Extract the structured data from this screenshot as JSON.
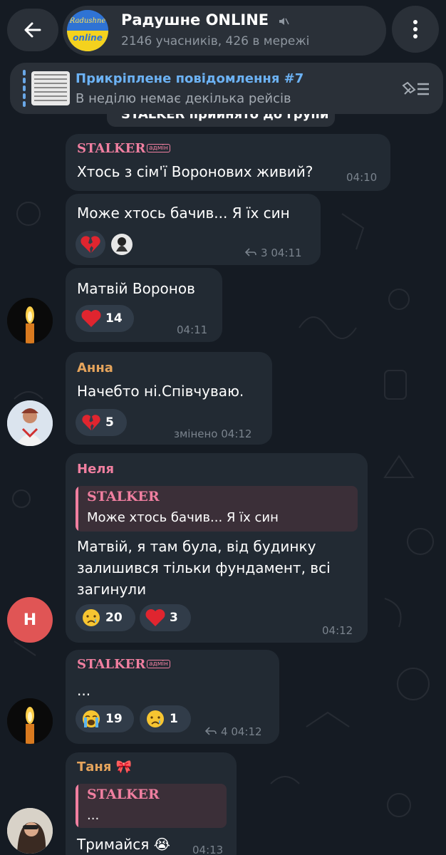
{
  "header": {
    "channel_title": "Радушне ONLINE",
    "channel_subtitle": "2146 учасників, 426 в мережі",
    "avatar_text_top": "Radushne",
    "avatar_text_bottom": "online"
  },
  "pinned": {
    "title": "Прикріплене повідомлення #7",
    "text": "В неділю немає декілька рейсів"
  },
  "service_text": "STALKER прийнято до групи",
  "admin_label": "адмін",
  "colors": {
    "background": "#151b23",
    "bubble": "#222a33",
    "accent_blue": "#6cb2f4",
    "name_pink": "#f07fa0",
    "name_orange": "#e5a45c",
    "reaction_bg": "#313c49"
  },
  "messages": [
    {
      "sender": "STALKER",
      "text": "Хтось з сім'ї Воронових живий?",
      "time": "04:10"
    },
    {
      "text": "Може хтось бачив... Я їх син",
      "forwards": "3",
      "time": "04:11",
      "reactions": [
        {
          "icon": "broken-heart"
        },
        {
          "icon": "avatar-photo"
        }
      ]
    },
    {
      "text": "Матвій Воронов",
      "time": "04:11",
      "reactions": [
        {
          "icon": "red-heart",
          "count": "14"
        }
      ]
    },
    {
      "sender": "Анна",
      "text": "Начебто ні.Співчуваю.",
      "time": "змінено 04:12",
      "reactions": [
        {
          "icon": "broken-heart",
          "count": "5"
        }
      ]
    },
    {
      "sender": "Неля",
      "quote_name": "STALKER",
      "quote_text": "Може хтось бачив... Я їх син",
      "text_lines": [
        "Матвій, я там була, від будинку",
        "залишився тільки фундамент, всі",
        "загинули"
      ],
      "time": "04:12",
      "reactions": [
        {
          "icon": "crying-face",
          "count": "20"
        },
        {
          "icon": "red-heart",
          "count": "3"
        }
      ],
      "avatar_letter": "Н"
    },
    {
      "sender": "STALKER",
      "text": "...",
      "forwards": "4",
      "time": "04:12",
      "reactions": [
        {
          "icon": "loudly-crying-face",
          "count": "19"
        },
        {
          "icon": "crying-face",
          "count": "1"
        }
      ]
    },
    {
      "sender": "Таня",
      "sender_emoji": "🎀",
      "quote_name": "STALKER",
      "quote_text": "...",
      "text": "Тримайся",
      "text_emoji": "😭",
      "time": "04:13"
    }
  ]
}
